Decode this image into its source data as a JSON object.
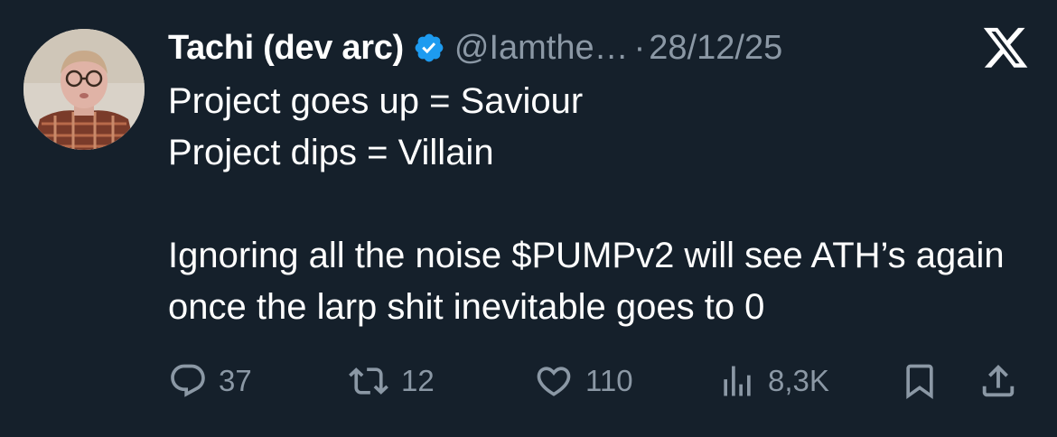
{
  "tweet": {
    "display_name": "Tachi (dev arc)",
    "handle": "@Iamthe…",
    "separator": "·",
    "date": "28/12/25",
    "text": "Project goes up = Saviour\nProject dips = Villain\n\nIgnoring all the noise $PUMPv2 will see ATH’s again once the larp shit inevitable goes to 0"
  },
  "icons": {
    "verified": "verified-badge-icon",
    "brand": "x-logo-icon",
    "reply": "reply-icon",
    "retweet": "retweet-icon",
    "like": "heart-icon",
    "views": "views-chart-icon",
    "bookmark": "bookmark-icon",
    "share": "share-icon"
  },
  "metrics": {
    "replies": "37",
    "retweets": "12",
    "likes": "110",
    "views": "8,3K"
  },
  "colors": {
    "background": "#15202b",
    "text": "#ffffff",
    "secondary": "#8b98a5",
    "verified": "#1d9bf0"
  }
}
